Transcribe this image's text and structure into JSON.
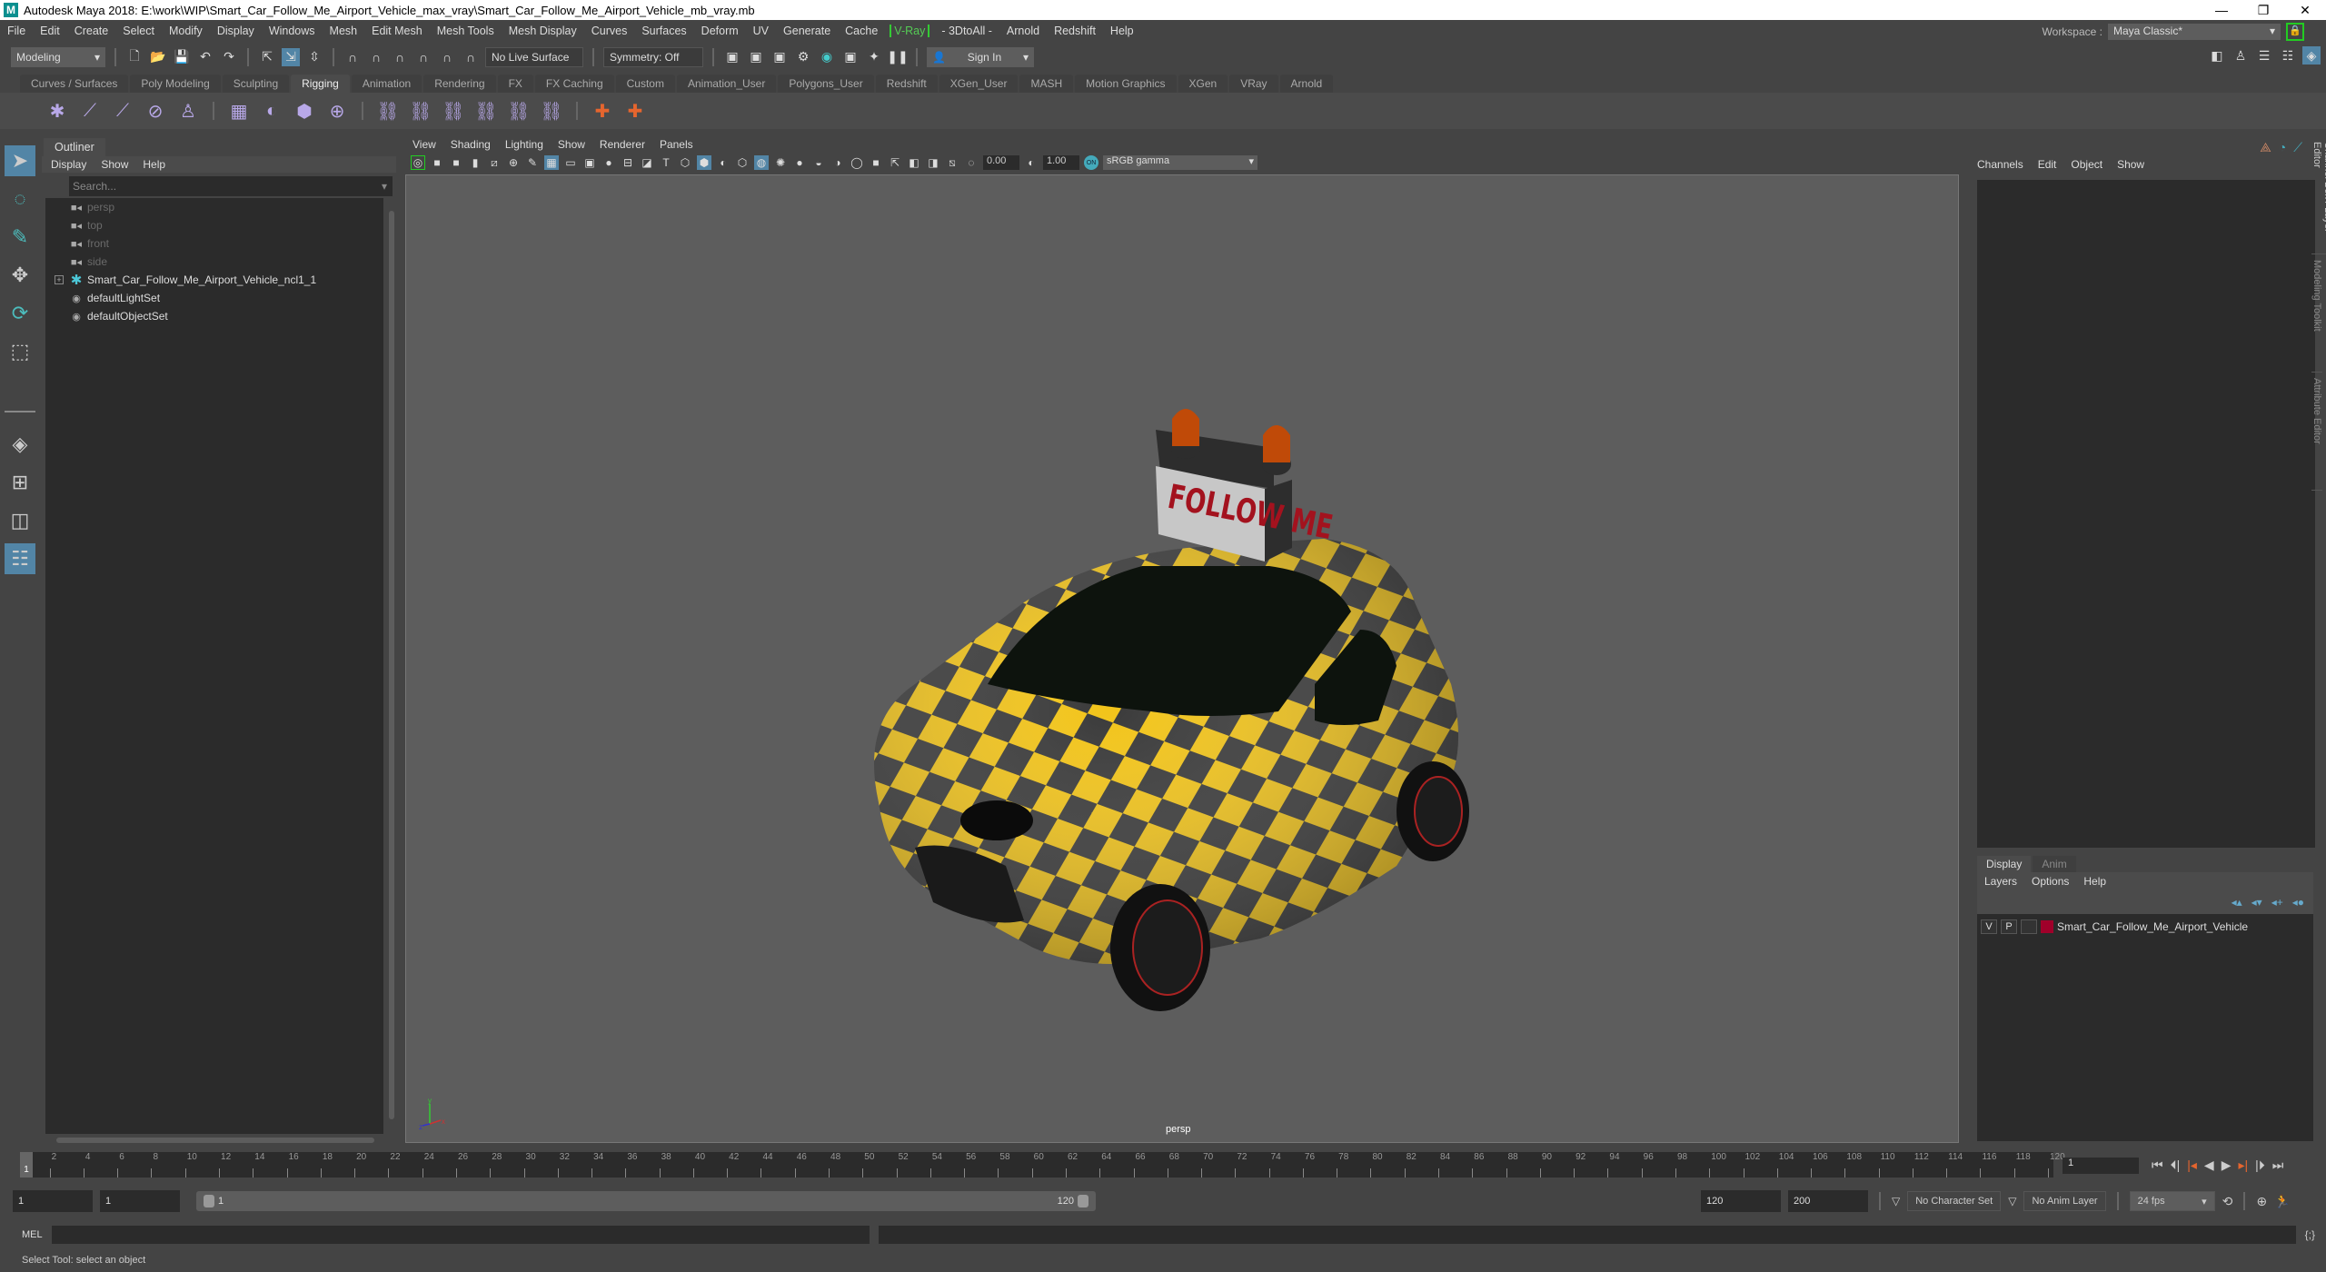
{
  "window": {
    "title": "Autodesk Maya 2018: E:\\work\\WIP\\Smart_Car_Follow_Me_Airport_Vehicle_max_vray\\Smart_Car_Follow_Me_Airport_Vehicle_mb_vray.mb",
    "logo": "M",
    "controls": [
      "—",
      "❐",
      "✕"
    ]
  },
  "menubar": {
    "items": [
      "File",
      "Edit",
      "Create",
      "Select",
      "Modify",
      "Display",
      "Windows",
      "Mesh",
      "Edit Mesh",
      "Mesh Tools",
      "Mesh Display",
      "Curves",
      "Surfaces",
      "Deform",
      "UV",
      "Generate",
      "Cache",
      "V-Ray",
      "- 3DtoAll -",
      "Arnold",
      "Redshift",
      "Help"
    ],
    "workspace_label": "Workspace :",
    "workspace_value": "Maya Classic*"
  },
  "statusline": {
    "mode": "Modeling",
    "live_surface": "No Live Surface",
    "symmetry": "Symmetry: Off",
    "sign_in": "Sign In"
  },
  "shelf": {
    "tabs": [
      "Curves / Surfaces",
      "Poly Modeling",
      "Sculpting",
      "Rigging",
      "Animation",
      "Rendering",
      "FX",
      "FX Caching",
      "Custom",
      "Animation_User",
      "Polygons_User",
      "Redshift",
      "XGen_User",
      "MASH",
      "Motion Graphics",
      "XGen",
      "VRay",
      "Arnold"
    ],
    "active_tab": "Rigging"
  },
  "outliner": {
    "title": "Outliner",
    "menu": [
      "Display",
      "Show",
      "Help"
    ],
    "search_placeholder": "Search...",
    "nodes": [
      {
        "label": "persp",
        "icon": "camera-icon",
        "dim": true
      },
      {
        "label": "top",
        "icon": "camera-icon",
        "dim": true
      },
      {
        "label": "front",
        "icon": "camera-icon",
        "dim": true
      },
      {
        "label": "side",
        "icon": "camera-icon",
        "dim": true
      },
      {
        "label": "Smart_Car_Follow_Me_Airport_Vehicle_ncl1_1",
        "icon": "group-icon",
        "expandable": true
      },
      {
        "label": "defaultLightSet",
        "icon": "set-icon"
      },
      {
        "label": "defaultObjectSet",
        "icon": "set-icon"
      }
    ]
  },
  "viewport": {
    "menu": [
      "View",
      "Shading",
      "Lighting",
      "Show",
      "Renderer",
      "Panels"
    ],
    "exposure": "0.00",
    "gamma": "1.00",
    "color_management": "sRGB gamma",
    "cm_on": "ON",
    "camera": "persp",
    "sign_text": "FOLLOW ME",
    "axis": {
      "x": "x",
      "y": "y",
      "z": "z"
    }
  },
  "channelbox": {
    "menu": [
      "Channels",
      "Edit",
      "Object",
      "Show"
    ]
  },
  "layereditor": {
    "tabs": [
      "Display",
      "Anim"
    ],
    "active_tab": "Display",
    "menu": [
      "Layers",
      "Options",
      "Help"
    ],
    "layers": [
      {
        "v": "V",
        "p": "P",
        "name": "Smart_Car_Follow_Me_Airport_Vehicle",
        "color": "#a0002a"
      }
    ]
  },
  "side_tabs": [
    "Channel Box / Layer Editor",
    "Modeling Toolkit",
    "Attribute Editor"
  ],
  "timeline": {
    "start": 1,
    "end": 120,
    "current_frame": "1",
    "current_field": "1",
    "labels_step": 2
  },
  "range": {
    "start_field": "1",
    "anim_start": "1",
    "slider_start": "1",
    "slider_end": "120",
    "end_field": "120",
    "anim_end": "200",
    "character_set": "No Character Set",
    "anim_layer": "No Anim Layer",
    "fps": "24 fps"
  },
  "cmdline": {
    "label": "MEL"
  },
  "helpline": {
    "text": "Select Tool: select an object"
  }
}
